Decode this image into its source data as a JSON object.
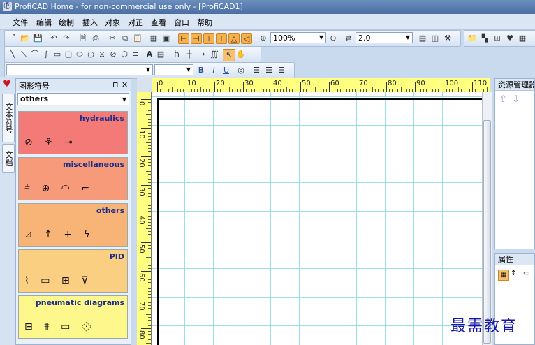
{
  "window": {
    "title": "ProfiCAD Home - for non-commercial use only - [ProfiCAD1]"
  },
  "menu": [
    "文件",
    "编辑",
    "绘制",
    "插入",
    "对象",
    "对正",
    "查看",
    "窗口",
    "帮助"
  ],
  "toolbar": {
    "zoom_value": "100%",
    "line_width_value": "2.0"
  },
  "side_tabs": [
    "文本符号",
    "文档"
  ],
  "symbol_panel": {
    "title": "图形符号",
    "pin_glyph": "⊓",
    "close_glyph": "✕",
    "category_combo": "others",
    "categories": [
      {
        "name": "hydraulics",
        "icons": "⊘ ⚘ ⊸",
        "color": "#f47a78"
      },
      {
        "name": "miscellaneous",
        "icons": "⫩ ⊕ ◠ ⌐",
        "color": "#f79a7a"
      },
      {
        "name": "others",
        "icons": "⊿ ↑ + ϟ",
        "color": "#f7b476"
      },
      {
        "name": "PID",
        "icons": "⌇ ▭ ⊞ ⊽",
        "color": "#fbcf82"
      },
      {
        "name": "pneumatic diagrams",
        "icons": "⊟ ⩩ ▭ ⟐",
        "color": "#fdf78c"
      }
    ]
  },
  "ruler": {
    "h_labels": [
      "0",
      "10",
      "20",
      "30",
      "40",
      "50",
      "60",
      "70",
      "80",
      "90",
      "100",
      "110"
    ],
    "v_labels": [
      "0",
      "10",
      "20",
      "30",
      "40",
      "50",
      "60",
      "70",
      "80"
    ]
  },
  "resource_panel": {
    "title": "资源管理器"
  },
  "property_panel": {
    "title": "属性"
  },
  "watermark": "最需教育"
}
